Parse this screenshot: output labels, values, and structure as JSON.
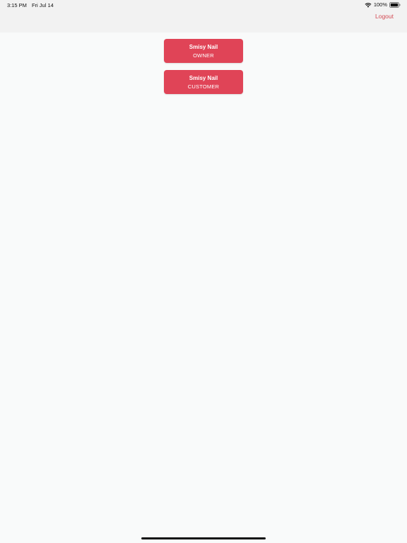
{
  "status_bar": {
    "time": "3:15 PM",
    "date": "Fri Jul 14",
    "battery": "100%",
    "icons": [
      "wifi-icon",
      "battery-icon"
    ]
  },
  "nav": {
    "logout_label": "Logout"
  },
  "accounts": [
    {
      "name": "Smisy Nail",
      "role": "OWNER"
    },
    {
      "name": "Smisy Nail",
      "role": "CUSTOMER"
    }
  ],
  "colors": {
    "accent": "#e04457",
    "logout": "#d34a53",
    "background": "#f9fafa",
    "header": "#f2f2f2"
  }
}
